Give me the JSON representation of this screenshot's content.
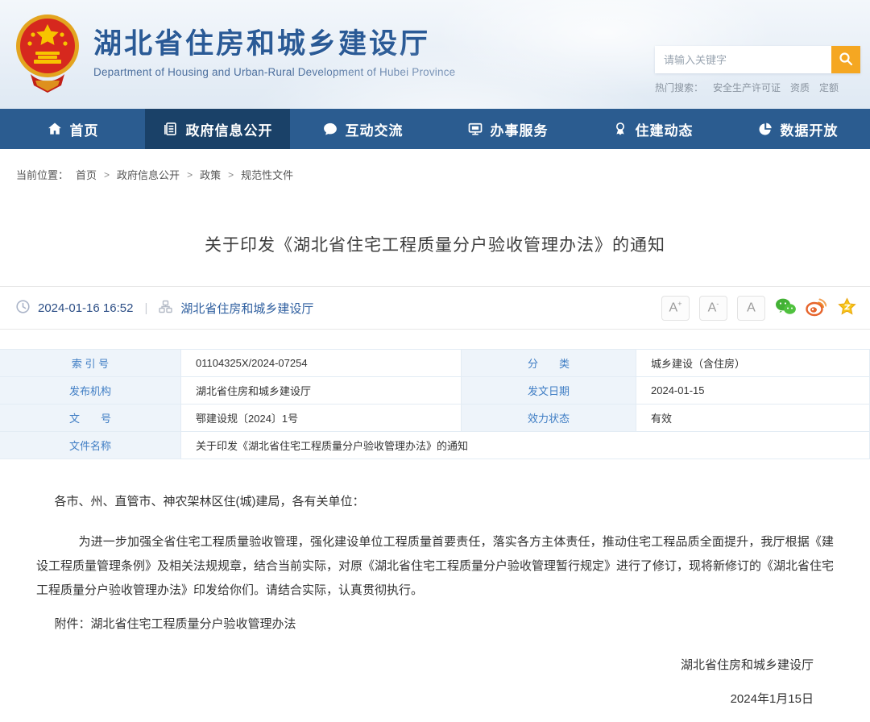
{
  "colors": {
    "accent_blue": "#2a5a96",
    "nav_bg": "#2b5c90",
    "nav_active_bg": "#1a4168",
    "search_button_orange": "#f5a722",
    "table_label_blue": "#3f7dc4",
    "wechat_green": "#43b135",
    "weibo_orange": "#e6642c",
    "star_gold": "#f7c517"
  },
  "header": {
    "logo": "china-national-emblem",
    "site_title": "湖北省住房和城乡建设厅",
    "site_subtitle": "Department of Housing and Urban-Rural Development of Hubei Province",
    "search": {
      "placeholder": "请输入关键字"
    },
    "hot_search": {
      "label": "热门搜索：",
      "items": [
        "安全生产许可证",
        "资质",
        "定额"
      ]
    }
  },
  "nav": {
    "items": [
      {
        "label": "首页",
        "icon": "home-icon",
        "active": false
      },
      {
        "label": "政府信息公开",
        "icon": "document-icon",
        "active": true
      },
      {
        "label": "互动交流",
        "icon": "chat-icon",
        "active": false
      },
      {
        "label": "办事服务",
        "icon": "monitor-icon",
        "active": false
      },
      {
        "label": "住建动态",
        "icon": "medal-icon",
        "active": false
      },
      {
        "label": "数据开放",
        "icon": "pie-chart-icon",
        "active": false
      }
    ]
  },
  "breadcrumb": {
    "label": "当前位置：",
    "separator": ">",
    "items": [
      "首页",
      "政府信息公开",
      "政策",
      "规范性文件"
    ]
  },
  "article": {
    "title": "关于印发《湖北省住宅工程质量分户验收管理办法》的通知",
    "meta": {
      "datetime": "2024-01-16 16:52",
      "divider": "|",
      "source": "湖北省住房和城乡建设厅",
      "font_size_buttons": [
        {
          "base": "A",
          "sup": "+"
        },
        {
          "base": "A",
          "sup": "-"
        },
        {
          "base": "A",
          "sup": ""
        }
      ]
    },
    "info_table": {
      "rows": [
        {
          "label1": "索 引 号",
          "value1": "01104325X/2024-07254",
          "label2": "分　　类",
          "value2": "城乡建设（含住房）"
        },
        {
          "label1": "发布机构",
          "value1": "湖北省住房和城乡建设厅",
          "label2": "发文日期",
          "value2": "2024-01-15"
        },
        {
          "label1": "文　　号",
          "value1": "鄂建设规〔2024〕1号",
          "label2": "效力状态",
          "value2": "有效"
        },
        {
          "label1": "文件名称",
          "value1": "关于印发《湖北省住宅工程质量分户验收管理办法》的通知"
        }
      ]
    },
    "body": {
      "salutation": "各市、州、直管市、神农架林区住(城)建局，各有关单位：",
      "paragraph1": "为进一步加强全省住宅工程质量验收管理，强化建设单位工程质量首要责任，落实各方主体责任，推动住宅工程品质全面提升，我厅根据《建设工程质量管理条例》及相关法规规章，结合当前实际，对原《湖北省住宅工程质量分户验收管理暂行规定》进行了修订，现将新修订的《湖北省住宅工程质量分户验收管理办法》印发给你们。请结合实际，认真贯彻执行。",
      "attachment": "附件：湖北省住宅工程质量分户验收管理办法"
    },
    "signature": {
      "org": "湖北省住房和城乡建设厅",
      "date": "2024年1月15日"
    }
  }
}
